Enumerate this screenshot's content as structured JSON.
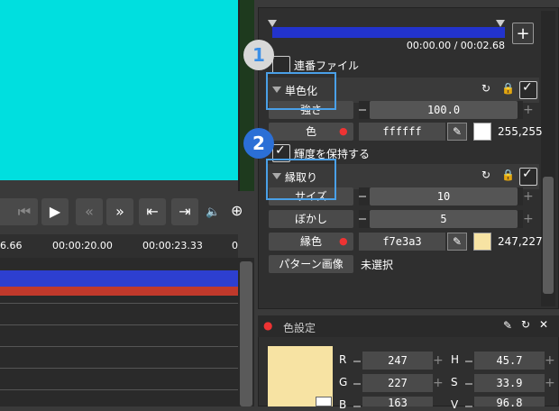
{
  "timeline": {
    "ticks": [
      "6.66",
      "00:00:20.00",
      "00:00:23.33",
      "0"
    ]
  },
  "seek": {
    "time": "00:00.00 / 00:02.68"
  },
  "sequence": {
    "label": "連番ファイル"
  },
  "monochrome": {
    "title": "単色化",
    "strength_label": "強さ",
    "strength_value": "100.0",
    "color_label": "色",
    "color_hex": "ffffff",
    "color_rgb": "255,255",
    "keep_luma_label": "輝度を保持する",
    "swatch_color": "#ffffff"
  },
  "border": {
    "title": "縁取り",
    "size_label": "サイズ",
    "size_value": "10",
    "blur_label": "ぼかし",
    "blur_value": "5",
    "color_label": "縁色",
    "color_hex": "f7e3a3",
    "color_rgb": "247,227",
    "pattern_label": "パターン画像",
    "pattern_value": "未選択",
    "swatch_color": "#f7e3a3"
  },
  "callouts": [
    "1",
    "2"
  ],
  "color_settings": {
    "title": "色設定",
    "r_label": "R",
    "r_value": "247",
    "g_label": "G",
    "g_value": "227",
    "b_label": "B",
    "b_value": "163",
    "h_label": "H",
    "h_value": "45.7",
    "s_label": "S",
    "s_value": "33.9",
    "v_label": "V",
    "v_value": "96.8"
  }
}
